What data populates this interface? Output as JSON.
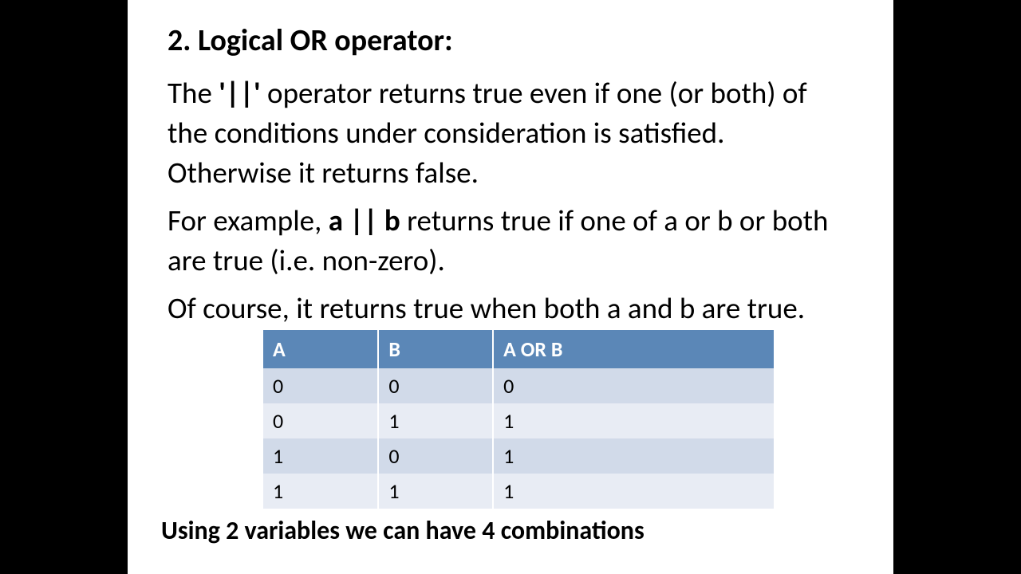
{
  "heading": "2. Logical OR operator:",
  "para1_a": "The ",
  "para1_b": "'||'",
  "para1_c": " operator returns true even if one (or both) of the conditions under consideration is satisfied. Otherwise it returns false.",
  "para2_a": "For example, ",
  "para2_b": "a || b",
  "para2_c": " returns true if one of a or b or both are true (i.e. non-zero).",
  "para3": "Of course, it returns true when both a and b are true.",
  "footer": "Using 2 variables we can have 4 combinations",
  "chart_data": {
    "type": "table",
    "headers": [
      "A",
      "B",
      "A OR B"
    ],
    "rows": [
      [
        "0",
        "0",
        "0"
      ],
      [
        "0",
        "1",
        "1"
      ],
      [
        "1",
        "0",
        "1"
      ],
      [
        "1",
        "1",
        "1"
      ]
    ]
  }
}
